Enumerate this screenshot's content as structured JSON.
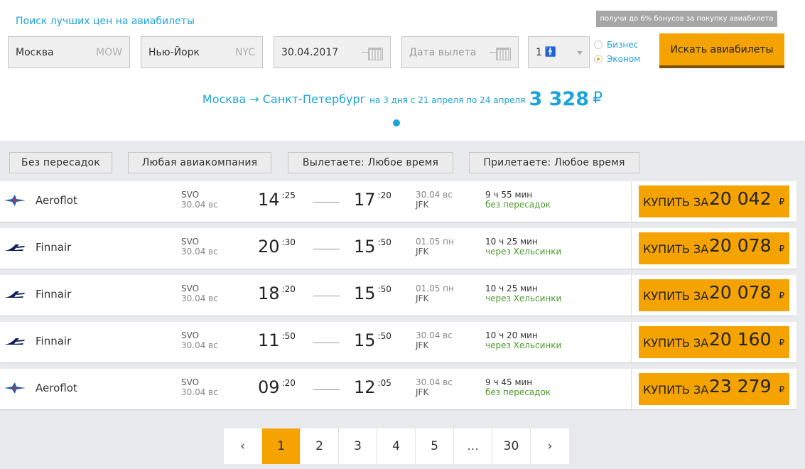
{
  "header": {
    "title": "Поиск лучших цен на авиабилеты",
    "bonus": "получи до 6% бонусов за покупку авиабилета",
    "from": {
      "city": "Москва",
      "code": "MOW"
    },
    "to": {
      "city": "Нью-Йорк",
      "code": "NYC"
    },
    "depart_date": "30.04.2017",
    "return_placeholder": "Дата вылета",
    "passengers": "1",
    "class_business": "Бизнес",
    "class_economy": "Эконом",
    "search_button": "Искать авиабилеты"
  },
  "promo": {
    "route": "Москва → Санкт-Петербург",
    "dates": "на 3 дня с 21 апреля по 24 апреля",
    "price": "3 328",
    "currency": "₽"
  },
  "filters": [
    "Без пересадок",
    "Любая авиакомпания",
    "Вылетаете: Любое время",
    "Прилетаете: Любое время"
  ],
  "buy_label": "КУПИТЬ ЗА",
  "currency_symbol": "₽",
  "flights": [
    {
      "airline": "Aeroflot",
      "logo": "aeroflot-logo",
      "dep_code": "SVO",
      "dep_date": "30.04 вс",
      "dep_h": "14",
      "dep_m": ":25",
      "arr_h": "17",
      "arr_m": ":20",
      "arr_date": "30.04 вс",
      "arr_code": "JFK",
      "duration": "9 ч 55 мин",
      "stops": "без пересадок",
      "price": "20 042"
    },
    {
      "airline": "Finnair",
      "logo": "finnair-logo",
      "dep_code": "SVO",
      "dep_date": "30.04 вс",
      "dep_h": "20",
      "dep_m": ":30",
      "arr_h": "15",
      "arr_m": ":50",
      "arr_date": "01.05 пн",
      "arr_code": "JFK",
      "duration": "10 ч 25 мин",
      "stops": "через Хельсинки",
      "price": "20 078"
    },
    {
      "airline": "Finnair",
      "logo": "finnair-logo",
      "dep_code": "SVO",
      "dep_date": "30.04 вс",
      "dep_h": "18",
      "dep_m": ":20",
      "arr_h": "15",
      "arr_m": ":50",
      "arr_date": "01.05 пн",
      "arr_code": "JFK",
      "duration": "10 ч 25 мин",
      "stops": "через Хельсинки",
      "price": "20 078"
    },
    {
      "airline": "Finnair",
      "logo": "finnair-logo",
      "dep_code": "SVO",
      "dep_date": "30.04 вс",
      "dep_h": "11",
      "dep_m": ":50",
      "arr_h": "15",
      "arr_m": ":50",
      "arr_date": "30.04 вс",
      "arr_code": "JFK",
      "duration": "10 ч 20 мин",
      "stops": "через Хельсинки",
      "price": "20 160"
    },
    {
      "airline": "Aeroflot",
      "logo": "aeroflot-logo",
      "dep_code": "SVO",
      "dep_date": "30.04 вс",
      "dep_h": "09",
      "dep_m": ":20",
      "arr_h": "12",
      "arr_m": ":05",
      "arr_date": "30.04 вс",
      "arr_code": "JFK",
      "duration": "9 ч 45 мин",
      "stops": "без пересадок",
      "price": "23 279"
    }
  ],
  "pagination": {
    "prev": "‹",
    "pages": [
      "1",
      "2",
      "3",
      "4",
      "5"
    ],
    "ellipsis": "...",
    "last": "30",
    "next": "›",
    "current": "1"
  },
  "colors": {
    "accent": "#f5a300",
    "link": "#1ba4d9",
    "stops_green": "#4a9a2a"
  }
}
